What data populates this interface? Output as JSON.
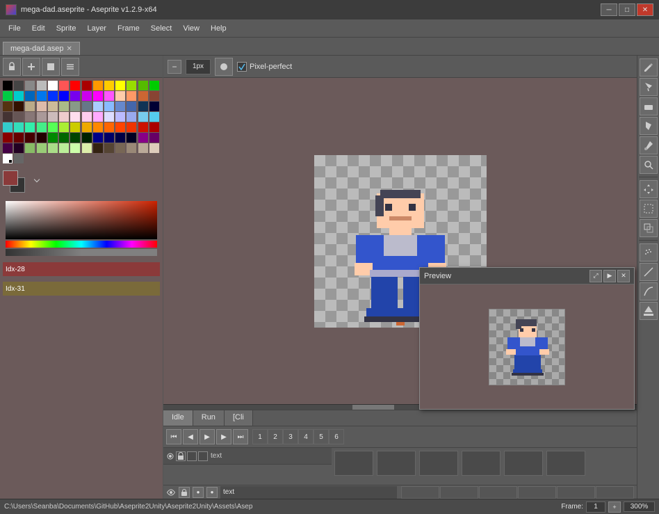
{
  "window": {
    "title": "mega-dad.aseprite - Aseprite v1.2.9-x64",
    "icon": "sprite-icon"
  },
  "menubar": {
    "items": [
      "File",
      "Edit",
      "Sprite",
      "Layer",
      "Frame",
      "Select",
      "View",
      "Help"
    ]
  },
  "tabs": [
    {
      "label": "mega-dad.asep",
      "active": true
    }
  ],
  "toolbar_top": {
    "buttons": [
      "lock",
      "add",
      "stop",
      "menu"
    ]
  },
  "canvas_toolbar": {
    "minus_label": "-",
    "brush_size": "1px",
    "pixel_perfect_label": "Pixel-perfect",
    "pixel_perfect_checked": true
  },
  "palette": {
    "colors": [
      "#000000",
      "#ffffff",
      "#aaaaaa",
      "#555555",
      "#ff0000",
      "#00ff00",
      "#0000ff",
      "#ffff00",
      "#ff00ff",
      "#00ffff",
      "#884400",
      "#ffaa00",
      "#ff6600",
      "#884422",
      "#ffcc88",
      "#ffddaa",
      "#ddbb88",
      "#cc9966",
      "#336600",
      "#55aa00",
      "#88cc44",
      "#aaddaa",
      "#003388",
      "#0055cc",
      "#2288ff",
      "#aaccff",
      "#660088",
      "#8833cc",
      "#cc66ff",
      "#ffaaff",
      "#330000",
      "#660000",
      "#990000",
      "#cc0000",
      "#440022",
      "#881144",
      "#cc2255",
      "#ff5588",
      "#003300",
      "#005500",
      "#008800",
      "#33aa33",
      "#000044",
      "#000088",
      "#2200aa",
      "#5522dd",
      "#111111",
      "#333333",
      "#666666",
      "#888888",
      "#aaaaaa",
      "#cccccc",
      "#eeeeee",
      "#ffffff",
      "#442200",
      "#664400",
      "#886622",
      "#ccaa55",
      "#330022",
      "#550033",
      "#880055",
      "#cc2288",
      "#001122",
      "#002244",
      "#003366",
      "#224488",
      "#440011",
      "#660022",
      "#881133",
      "#bb2244",
      "#004422",
      "#006633",
      "#119944",
      "#33bb66",
      "#220044",
      "#440066",
      "#661188",
      "#991199",
      "#ffddbb",
      "#ffcc99",
      "#ffbb77",
      "#ffaa55",
      "#665544",
      "#887766",
      "#aabb99",
      "#ccdde0",
      "#88aacc",
      "#4466aa",
      "#224488",
      "#112266",
      "#cc8833",
      "#bb7722",
      "#aa6611",
      "#884400",
      "#887755",
      "#996633",
      "#663300",
      "#442200",
      "#222222",
      "#444444",
      "#666666",
      "#888888",
      "#222233",
      "#444466",
      "#6677aa",
      "#aabbcc",
      "#eeff00",
      "#ccdd00",
      "#aabb00",
      "#889900",
      "#220011",
      "#440022",
      "#660033",
      "#880044",
      "#cc3366",
      "#ee5588",
      "#ff88aa",
      "#ffbbcc",
      "#aabb44",
      "#8899 33",
      "#667722",
      "#445511",
      "#ffcc00",
      "#ddaa00",
      "#bb8800",
      "#997700"
    ]
  },
  "color_swatch": {
    "fg": "#7a3a3a",
    "bg": "#3a3a3a",
    "index_label_1": "Idx-28",
    "index_label_2": "Idx-31"
  },
  "animation": {
    "tabs": [
      "Idle",
      "Run",
      "[Cli"
    ],
    "controls": [
      "first",
      "prev",
      "play",
      "next",
      "last"
    ],
    "frame_numbers": [
      "1",
      "2",
      "3",
      "4",
      "5",
      "6"
    ],
    "layers": [
      {
        "name": "text",
        "visible": true,
        "locked": false
      }
    ]
  },
  "preview": {
    "title": "Preview",
    "controls": [
      "maximize",
      "play",
      "close"
    ]
  },
  "statusbar": {
    "path": "C:\\Users\\Seanba\\Documents\\GitHub\\Aseprite2Unity\\Aseprite2Unity\\Assets\\Asep",
    "frame_label": "Frame:",
    "frame_value": "1",
    "zoom_value": "300%"
  },
  "icons": {
    "search": "🔍",
    "play": "▶",
    "pause": "⏸",
    "pencil": "✏",
    "eraser": "⬜",
    "bucket": "🪣",
    "eyedropper": "💧",
    "selection": "⬚",
    "move": "✥",
    "zoom": "🔎",
    "first_frame": "⏮",
    "prev_frame": "◀",
    "next_frame": "▶",
    "last_frame": "⏭"
  }
}
